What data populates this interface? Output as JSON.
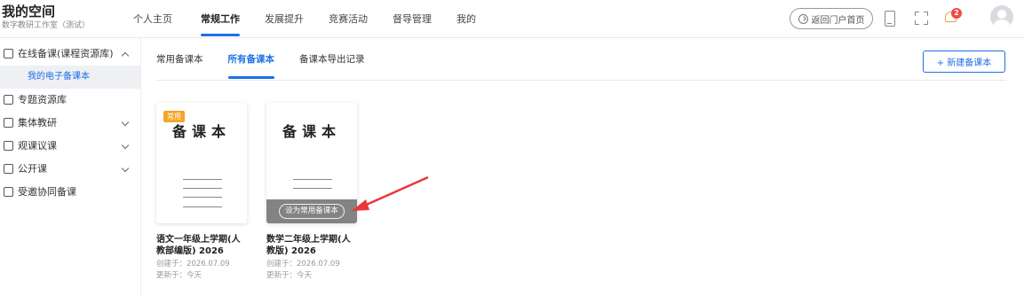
{
  "app": {
    "title": "我的空间",
    "subtitle": "数字教研工作室（测试）"
  },
  "nav": [
    {
      "label": "个人主页",
      "active": false
    },
    {
      "label": "常规工作",
      "active": true
    },
    {
      "label": "发展提升",
      "active": false
    },
    {
      "label": "竞赛活动",
      "active": false
    },
    {
      "label": "督导管理",
      "active": false
    },
    {
      "label": "我的",
      "active": false
    }
  ],
  "header": {
    "portal_button": "返回门户首页",
    "notification_count": "2"
  },
  "sidebar": {
    "items": [
      {
        "label": "在线备课(课程资源库)",
        "icon": "doc-icon",
        "expanded": true
      },
      {
        "label": "我的电子备课本",
        "sub": true,
        "active": true
      },
      {
        "label": "专题资源库",
        "icon": "folder-icon"
      },
      {
        "label": "集体教研",
        "icon": "list-icon",
        "expandable": true
      },
      {
        "label": "观课议课",
        "icon": "layout-icon",
        "expandable": true
      },
      {
        "label": "公开课",
        "icon": "video-icon",
        "expandable": true
      },
      {
        "label": "受邀协同备课",
        "icon": "group-icon"
      }
    ]
  },
  "tabs": [
    {
      "label": "常用备课本",
      "active": false
    },
    {
      "label": "所有备课本",
      "active": true
    },
    {
      "label": "备课本导出记录",
      "active": false
    }
  ],
  "new_button": "+ 新建备课本",
  "books": [
    {
      "cover_title": "备课本",
      "tag": "常用",
      "name": "语文一年级上学期(人教部编版) 2026",
      "created": "创建于：2026.07.09",
      "updated": "更新于：今天",
      "show_overlay": false
    },
    {
      "cover_title": "备课本",
      "tag": "",
      "name": "数学二年级上学期(人教版) 2026",
      "created": "创建于：2026.07.09",
      "updated": "更新于：今天",
      "show_overlay": true,
      "overlay_button": "设为常用备课本"
    }
  ],
  "colors": {
    "accent": "#1f6fe5",
    "tag": "#f5a623",
    "badge": "#f04848",
    "arrow": "#e8363b"
  }
}
